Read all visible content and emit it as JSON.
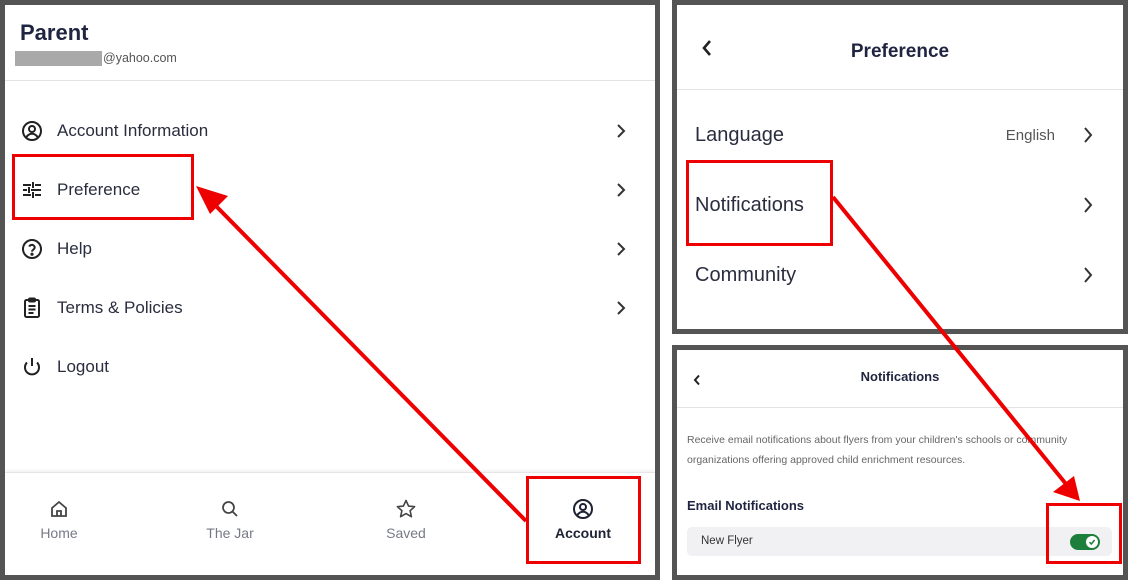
{
  "account_panel": {
    "title": "Parent",
    "email_suffix": "@yahoo.com",
    "menu": [
      {
        "label": "Account Information",
        "icon": "user-circle-icon"
      },
      {
        "label": "Preference",
        "icon": "sliders-icon"
      },
      {
        "label": "Help",
        "icon": "question-circle-icon"
      },
      {
        "label": "Terms & Policies",
        "icon": "clipboard-icon"
      },
      {
        "label": "Logout",
        "icon": "power-icon"
      }
    ],
    "bottom_nav": [
      {
        "label": "Home",
        "icon": "home-icon"
      },
      {
        "label": "The Jar",
        "icon": "search-icon"
      },
      {
        "label": "Saved",
        "icon": "star-icon"
      },
      {
        "label": "Account",
        "icon": "user-circle-icon",
        "active": true
      }
    ]
  },
  "preference_panel": {
    "title": "Preference",
    "rows": [
      {
        "label": "Language",
        "value": "English"
      },
      {
        "label": "Notifications",
        "value": ""
      },
      {
        "label": "Community",
        "value": ""
      }
    ]
  },
  "notifications_panel": {
    "title": "Notifications",
    "description": "Receive email notifications about flyers from your children's schools or community organizations offering approved child enrichment resources.",
    "section_title": "Email Notifications",
    "toggle_label": "New Flyer",
    "toggle_on": true
  },
  "colors": {
    "highlight": "#ee0000",
    "panel_border": "#545454",
    "toggle_on": "#1e7f3c",
    "title_text": "#1f2540"
  }
}
